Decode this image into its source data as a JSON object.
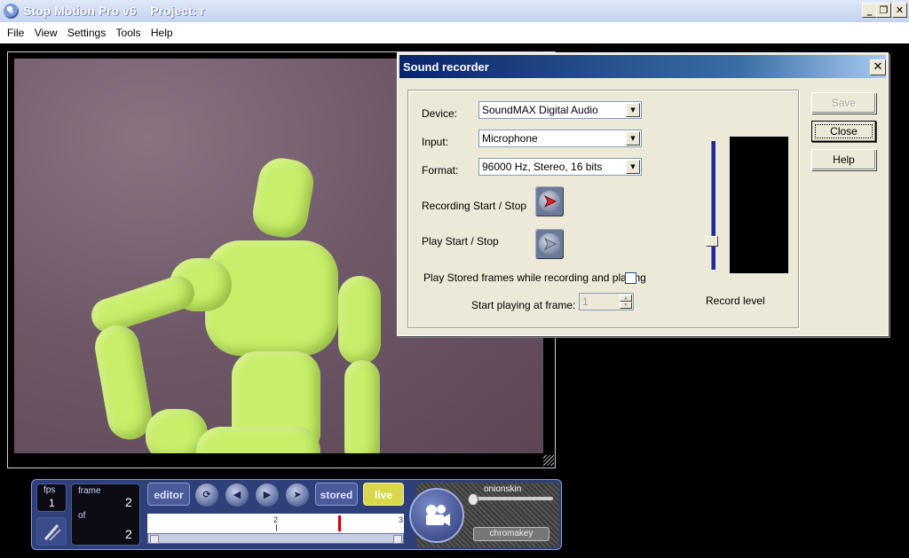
{
  "app": {
    "title": "Stop Motion Pro v6    Project: r",
    "icon_label": "6"
  },
  "window_controls": {
    "minimize": "_",
    "restore": "❐",
    "close": "✕"
  },
  "menu": [
    "File",
    "View",
    "Settings",
    "Tools",
    "Help"
  ],
  "dialog": {
    "title": "Sound recorder",
    "close_glyph": "✕",
    "device": {
      "label": "Device:",
      "value": "SoundMAX Digital Audio"
    },
    "input": {
      "label": "Input:",
      "value": "Microphone"
    },
    "format": {
      "label": "Format:",
      "value": "96000 Hz, Stereo, 16 bits"
    },
    "recording_label": "Recording Start / Stop",
    "play_label": "Play Start / Stop",
    "stored_frames_label": "Play Stored frames while recording and playing",
    "stored_frames_checked": false,
    "start_frame_label": "Start playing at frame:",
    "start_frame_value": "1",
    "record_level_label": "Record level",
    "record_level_fraction": 0.22,
    "buttons": {
      "save": "Save",
      "close": "Close",
      "help": "Help"
    }
  },
  "panel": {
    "fps_label": "fps",
    "fps_value": "1",
    "frame_label": "frame",
    "frame_value": "2",
    "of_label": "of",
    "of_value": "2",
    "editor_label": "editor",
    "stored_label": "stored",
    "live_label": "live",
    "onionskin_label": "onionskin",
    "chromakey_label": "chromakey",
    "timeline_tick_label": "2",
    "timeline_end_label": "3",
    "colors": {
      "panel": "#2e3f79",
      "live": "#d8d84a",
      "playhead": "#cc0000"
    }
  }
}
